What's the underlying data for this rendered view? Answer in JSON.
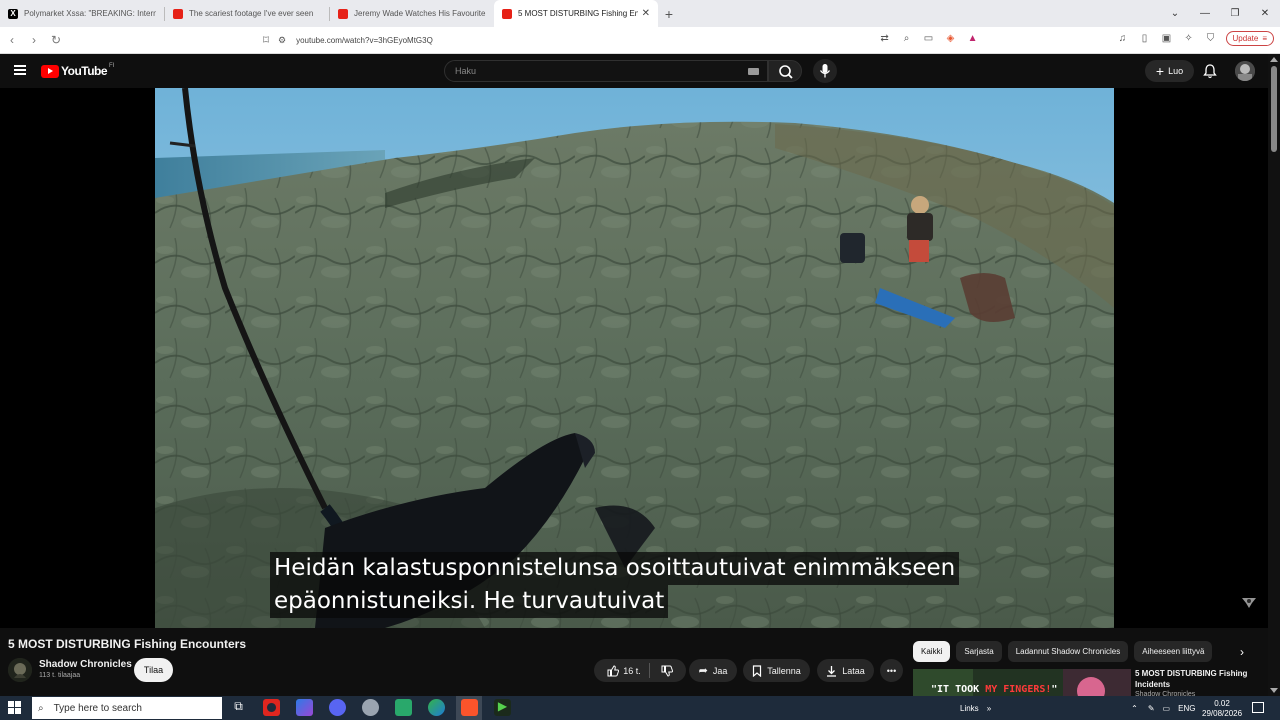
{
  "browser": {
    "tabs": [
      {
        "title": "Polymarket Xssa: \"BREAKING: Intern",
        "icon": "x-icon",
        "active": false
      },
      {
        "title": "The scariest footage I've ever seen",
        "icon": "youtube-icon",
        "active": false
      },
      {
        "title": "Jeremy Wade Watches His Favourite",
        "icon": "youtube-icon",
        "active": false
      },
      {
        "title": "5 MOST DISTURBING Fishing En",
        "icon": "youtube-icon",
        "active": true
      }
    ],
    "url": "youtube.com/watch?v=3hGEyoMtG3Q",
    "update_label": "Update"
  },
  "header": {
    "logo_text": "YouTube",
    "country_code": "FI",
    "search_placeholder": "Haku",
    "create_label": "Luo"
  },
  "video": {
    "subtitle_lines": [
      "Heidän kalastusponnistelunsa osoittautuivat enimmäkseen",
      "epäonnistuneiksi.  He turvautuivat"
    ],
    "title": "5 MOST DISTURBING Fishing Encounters"
  },
  "channel": {
    "name": "Shadow Chronicles",
    "subscribers": "113 t. tilaajaa",
    "subscribe_label": "Tilaa"
  },
  "actions": {
    "likes": "16 t.",
    "share": "Jaa",
    "save": "Tallenna",
    "download": "Lataa"
  },
  "chips": [
    "Kaikki",
    "Sarjasta",
    "Ladannut Shadow Chronicles",
    "Aiheeseen liittyvä"
  ],
  "recommendation": {
    "thumb_text_white": "\"IT TOOK ",
    "thumb_text_red": "MY FINGERS!",
    "thumb_text_end": "\"",
    "title": "5 MOST DISTURBING Fishing Incidents",
    "channel": "Shadow Chronicles"
  },
  "taskbar": {
    "search_placeholder": "Type here to search",
    "links_label": "Links",
    "language": "ENG",
    "time": "0.02",
    "date": "29/08/2026"
  }
}
